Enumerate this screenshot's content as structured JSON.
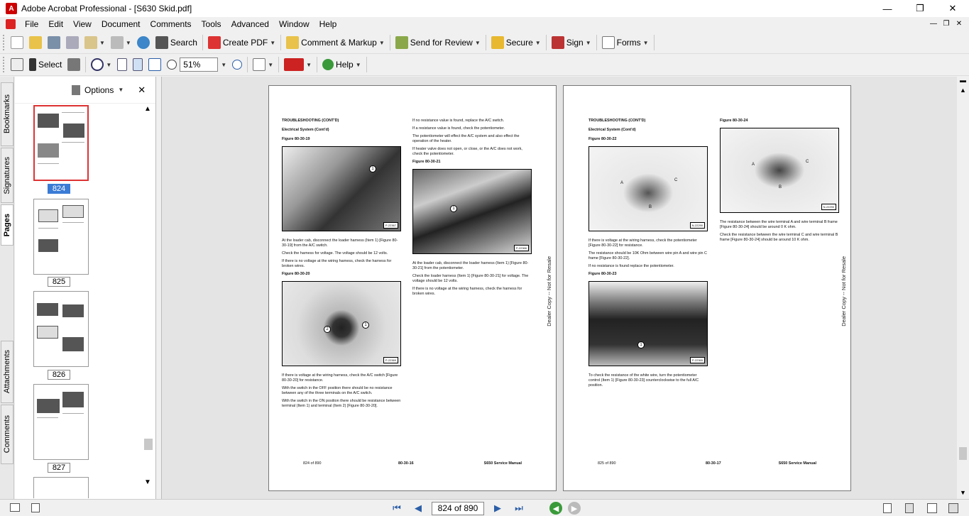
{
  "window": {
    "title": "Adobe Acrobat Professional - [S630 Skid.pdf]",
    "app_icon": "pdf-icon"
  },
  "menu": [
    "File",
    "Edit",
    "View",
    "Document",
    "Comments",
    "Tools",
    "Advanced",
    "Window",
    "Help"
  ],
  "toolbar1": {
    "search": "Search",
    "create_pdf": "Create PDF",
    "comment_markup": "Comment & Markup",
    "send_review": "Send for Review",
    "secure": "Secure",
    "sign": "Sign",
    "forms": "Forms"
  },
  "toolbar2": {
    "select": "Select",
    "zoom": "51%",
    "help": "Help"
  },
  "left_tabs": [
    "Bookmarks",
    "Signatures",
    "Pages",
    "Attachments",
    "Comments"
  ],
  "thumbnails": {
    "options": "Options",
    "pages": [
      "824",
      "825",
      "826",
      "827"
    ],
    "selected": "824"
  },
  "nav": {
    "page_display": "824 of 890"
  },
  "page_left": {
    "heading1": "TROUBLESHOOTING (CONT'D)",
    "heading2": "Electrical System (Cont'd)",
    "fig19": "Figure 80-30-19",
    "fig19_tag": "P-22367",
    "p1": "At the loader cab, disconnect the loader harness (Item 1) [Figure 80-30-19] from the A/C switch.",
    "p2": "Check the harness for voltage. The voltage should be 12 volts.",
    "p3": "If there is no voltage at the wiring harness, check the harness for broken wires.",
    "fig20": "Figure 80-30-20",
    "fig20_tag": "P-22369",
    "p4": "If there is voltage at the wiring harness, check the A/C switch [Figure 80-30-20] for resistance.",
    "p5": "With the switch in the OFF position there should be no resistance between any of the three terminals on the A/C switch.",
    "p6": "With the switch in the ON position there should be resistance between terminal (Item 1) and terminal (Item 2) [Figure 80-30-20].",
    "r1": "If no resistance value is found, replace the A/C switch.",
    "r2": "If a resistance value is found, check the potentiometer.",
    "r3": "The potentiometer will effect the A/C system and also effect the operation of the heater.",
    "r4": "If heater valve does not open, or close, or the A/C does not work, check the potentiometer.",
    "fig21": "Figure 80-30-21",
    "fig21_tag": "P-22366",
    "r5": "At the loader cab, disconnect the loader harness (Item 1) [Figure 80-30-21] from the potentiometer.",
    "r6": "Check the loader harness (Item 1) [Figure 80-30-21] for voltage. The voltage should be 12 volts.",
    "r7": "If there is no voltage at the wiring harness, check the harness for broken wires.",
    "footer_left": "824 of 890",
    "footer_mid": "80-30-16",
    "footer_right": "S650 Service Manual",
    "side": "Dealer Copy -- Not for Resale"
  },
  "page_right": {
    "heading1": "TROUBLESHOOTING (CONT'D)",
    "heading2": "Electrical System (Cont'd)",
    "fig22": "Figure 80-30-22",
    "fig22_tag": "N-22290",
    "p1": "If there is voltage at the wiring harness, check the potentiometer [Figure 80-30-22] for resistance.",
    "p2": "The resistance should be 10K Ohm between wire pin A and wire pin C frame [Figure 80-30-22].",
    "p3": "If no resistance is found replace the potentiometer.",
    "fig23": "Figure 80-30-23",
    "fig23_tag": "P-22365",
    "p4": "To check the resistance of the white wire, turn the potentiometer control (Item 1) [Figure 80-30-23] counterclockwise to the full A/C position.",
    "fig24": "Figure 80-30-24",
    "fig24_tag": "N-22290",
    "r1": "The resistance between the wire terminal A and wire terminal B frame [Figure 80-30-24] should be around 0 K ohm.",
    "r2": "Check the resistance between the wire terminal C and wire terminal B frame [Figure 80-30-24] should be around 10 K ohm.",
    "footer_left": "825 of 890",
    "footer_mid": "80-30-17",
    "footer_right": "S650 Service Manual",
    "side": "Dealer Copy -- Not for Resale"
  },
  "callouts": {
    "one": "1",
    "two": "2",
    "a": "A",
    "b": "B",
    "c": "C"
  }
}
